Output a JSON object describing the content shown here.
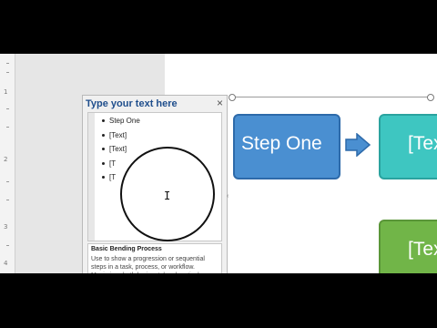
{
  "text_pane": {
    "title": "Type your text here",
    "close_glyph": "×",
    "items": [
      "Step One",
      "[Text]",
      "[Text]",
      "[T",
      "[T"
    ],
    "cursor_glyph": "I"
  },
  "description": {
    "title": "Basic Bending Process",
    "body": "Use to show a progression or sequential steps in a task, process, or workflow. Maximizes both horizontal and vertical display space for"
  },
  "smartart": {
    "shape1": "Step One",
    "shape2": "[Tex",
    "shape3": "[Tex",
    "colors": {
      "blue": "#4a8fd1",
      "teal": "#3ec6c1",
      "green": "#71b548"
    }
  },
  "ruler": {
    "labels": [
      "1",
      "2",
      "3",
      "4"
    ]
  }
}
